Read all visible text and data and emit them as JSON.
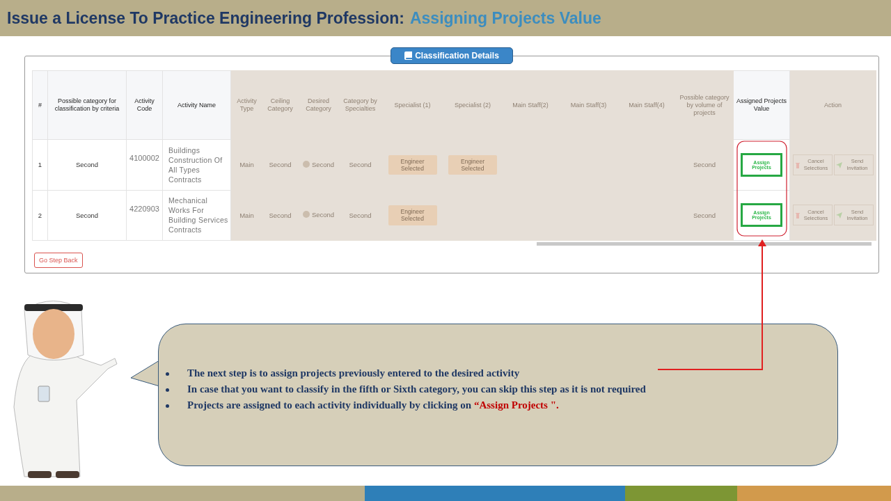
{
  "header": {
    "title": "Issue a License To Practice Engineering Profession:",
    "subtitle": "Assigning Projects Value"
  },
  "panel": {
    "legend": "Classification Details",
    "columns": [
      {
        "label": "#",
        "dimmed": false
      },
      {
        "label": "Possible category for classification by criteria",
        "dimmed": false
      },
      {
        "label": "Activity Code",
        "dimmed": false
      },
      {
        "label": "Activity Name",
        "dimmed": false
      },
      {
        "label": "Activity Type",
        "dimmed": true
      },
      {
        "label": "Ceiling Category",
        "dimmed": true
      },
      {
        "label": "Desired Category",
        "dimmed": true
      },
      {
        "label": "Category by Specialties",
        "dimmed": true
      },
      {
        "label": "Specialist (1)",
        "dimmed": true
      },
      {
        "label": "Specialist (2)",
        "dimmed": true
      },
      {
        "label": "Main Staff(2)",
        "dimmed": true
      },
      {
        "label": "Main Staff(3)",
        "dimmed": true
      },
      {
        "label": "Main Staff(4)",
        "dimmed": true
      },
      {
        "label": "Possible category by volume of projects",
        "dimmed": true
      },
      {
        "label": "Assigned Projects Value",
        "dimmed": false
      },
      {
        "label": "Action",
        "dimmed": true
      }
    ],
    "rows": [
      {
        "cells": [
          {
            "kind": "text",
            "text": "1"
          },
          {
            "kind": "text",
            "text": "Second"
          },
          {
            "kind": "code",
            "text": "4100002"
          },
          {
            "kind": "name",
            "text": "Buildings Construction Of All Types Contracts"
          },
          {
            "kind": "text",
            "text": "Main"
          },
          {
            "kind": "text",
            "text": "Second"
          },
          {
            "kind": "hint",
            "text": "Second"
          },
          {
            "kind": "text",
            "text": "Second"
          },
          {
            "kind": "button",
            "text": "Engineer Selected"
          },
          {
            "kind": "button",
            "text": "Engineer Selected"
          },
          {
            "kind": "blank"
          },
          {
            "kind": "blank"
          },
          {
            "kind": "blank"
          },
          {
            "kind": "text",
            "text": "Second"
          },
          {
            "kind": "assign",
            "text": "Assign Projects"
          },
          {
            "kind": "actions",
            "buttons": [
              "Cancel Selections",
              "Send Invitation"
            ]
          }
        ]
      },
      {
        "cells": [
          {
            "kind": "text",
            "text": "2"
          },
          {
            "kind": "text",
            "text": "Second"
          },
          {
            "kind": "code",
            "text": "4220903"
          },
          {
            "kind": "name",
            "text": "Mechanical Works For Building Services Contracts"
          },
          {
            "kind": "text",
            "text": "Main"
          },
          {
            "kind": "text",
            "text": "Second"
          },
          {
            "kind": "hint",
            "text": "Second"
          },
          {
            "kind": "text",
            "text": "Second"
          },
          {
            "kind": "button",
            "text": "Engineer Selected"
          },
          {
            "kind": "blank"
          },
          {
            "kind": "blank"
          },
          {
            "kind": "blank"
          },
          {
            "kind": "blank"
          },
          {
            "kind": "text",
            "text": "Second"
          },
          {
            "kind": "assign",
            "text": "Assign Projects"
          },
          {
            "kind": "actions",
            "buttons": [
              "Cancel Selections",
              "Send Invitation"
            ]
          }
        ]
      }
    ],
    "back_button": "Go Step Back"
  },
  "callout": {
    "bullets": [
      {
        "text": "The next step is to assign projects previously entered to the desired activity"
      },
      {
        "text": "In case that you want to classify in the fifth  or Sixth category, you can skip this step as it is not required"
      },
      {
        "text": "Projects are assigned  to each activity individually  by clicking  on",
        "highlight": "“Assign Projects \"."
      }
    ]
  },
  "footer": {
    "segments": [
      {
        "color": "#b8ae8a"
      },
      {
        "color": "#2e7fb8"
      },
      {
        "color": "#7d9634"
      },
      {
        "color": "#d29a4c"
      }
    ]
  }
}
